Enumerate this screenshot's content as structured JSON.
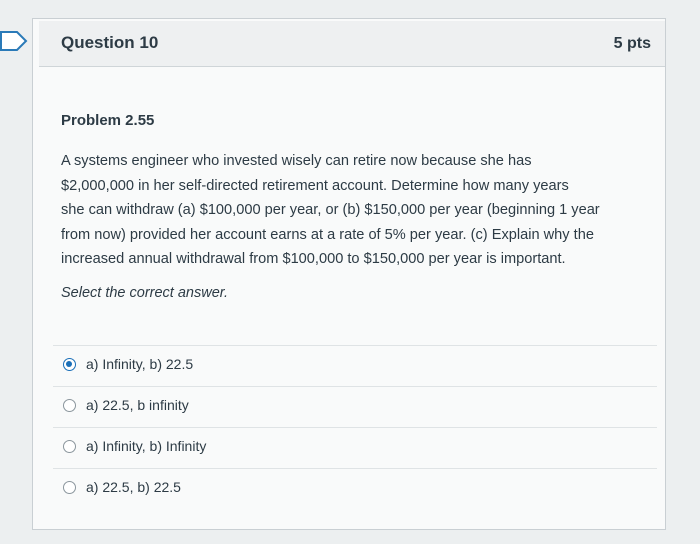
{
  "question": {
    "title": "Question 10",
    "points": "5 pts",
    "problem_title": "Problem 2.55",
    "problem_lines": [
      "A systems engineer who invested wisely can retire now because she has",
      "$2,000,000 in her self-directed retirement account. Determine how many years",
      "she can withdraw (a) $100,000 per year, or (b) $150,000 per year (beginning 1 year",
      "from now) provided her account earns at a rate of 5% per year. (c) Explain why the",
      "increased annual withdrawal from $100,000 to $150,000 per year is important."
    ],
    "prompt": "Select the correct answer.",
    "answers": [
      {
        "label": "a) Infinity, b) 22.5",
        "selected": true
      },
      {
        "label": "a) 22.5, b infinity",
        "selected": false
      },
      {
        "label": "a) Infinity, b) Infinity",
        "selected": false
      },
      {
        "label": "a) 22.5, b) 22.5",
        "selected": false
      }
    ]
  },
  "colors": {
    "accent": "#1a6fb8",
    "text": "#2d3b45",
    "background": "#eceff0"
  },
  "icons": {
    "bookmark": "bookmark-outline-icon"
  }
}
